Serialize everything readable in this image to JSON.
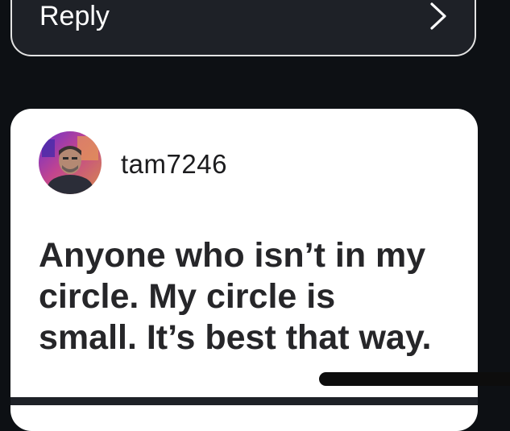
{
  "reply_card": {
    "label": "Reply",
    "chevron_icon": "chevron-right-icon"
  },
  "post": {
    "avatar_icon": "user-avatar",
    "username": "tam7246",
    "text": "Anyone who isn’t in my\ncircle. My circle is\nsmall. It’s best that way."
  },
  "colors": {
    "background": "#0d1014",
    "reply_card_bg": "#1e2127",
    "reply_card_border": "#e3e3e3",
    "post_card_bg": "#ffffff",
    "post_text": "#262629"
  }
}
